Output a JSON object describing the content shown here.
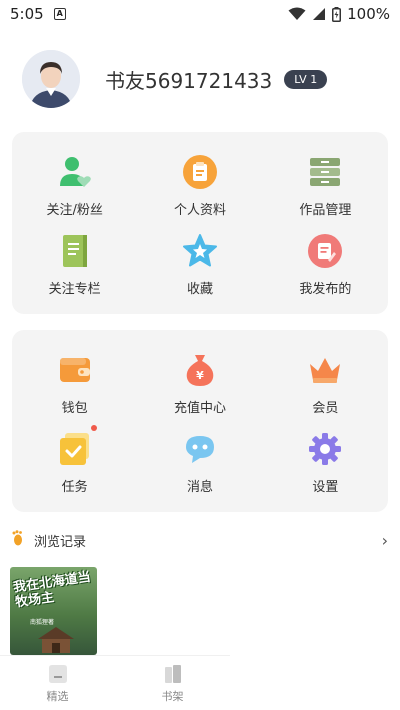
{
  "status_bar": {
    "time": "5:05",
    "notification_icon": "A",
    "battery": "100%"
  },
  "profile": {
    "nickname": "书友5691721433",
    "level": "LV 1"
  },
  "menu_card_1": [
    {
      "label": "关注/粉丝",
      "icon": "user-heart-icon",
      "color": "#3fbf6f"
    },
    {
      "label": "个人资料",
      "icon": "clipboard-icon",
      "color": "#f7a33a"
    },
    {
      "label": "作品管理",
      "icon": "drawer-icon",
      "color": "#8aa672"
    },
    {
      "label": "关注专栏",
      "icon": "notebook-icon",
      "color": "#9dc45a"
    },
    {
      "label": "收藏",
      "icon": "star-icon",
      "color": "#4bb8e8"
    },
    {
      "label": "我发布的",
      "icon": "edit-note-icon",
      "color": "#f07a78"
    }
  ],
  "menu_card_2": [
    {
      "label": "钱包",
      "icon": "wallet-icon",
      "color": "#f59a3a"
    },
    {
      "label": "充值中心",
      "icon": "money-bag-icon",
      "color": "#f5735a"
    },
    {
      "label": "会员",
      "icon": "crown-icon",
      "color": "#f5874a"
    },
    {
      "label": "任务",
      "icon": "task-check-icon",
      "color": "#f7c23a",
      "has_red_dot": true
    },
    {
      "label": "消息",
      "icon": "chat-bubble-icon",
      "color": "#7ac6f0"
    },
    {
      "label": "设置",
      "icon": "gear-icon",
      "color": "#8a7ae8"
    }
  ],
  "history": {
    "title": "浏览记录",
    "icon": "footprint-icon"
  },
  "recent_book": {
    "cover_title": "我在北海道当牧场主",
    "cover_author": "南狐狸著"
  },
  "tabbar": [
    {
      "label": "精选",
      "icon": "featured-icon"
    },
    {
      "label": "书架",
      "icon": "bookshelf-icon"
    }
  ],
  "colors": {
    "card_bg": "#f4f4f4",
    "badge_bg": "#3a4150",
    "red_dot": "#f05a4a"
  }
}
